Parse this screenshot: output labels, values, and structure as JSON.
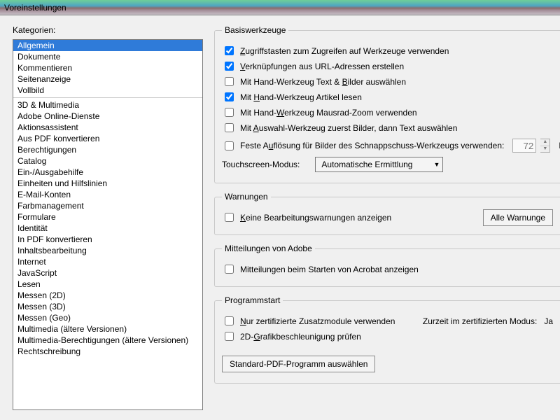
{
  "window": {
    "title": "Voreinstellungen"
  },
  "left": {
    "label": "Kategorien:",
    "groups": [
      {
        "items": [
          "Allgemein",
          "Dokumente",
          "Kommentieren",
          "Seitenanzeige",
          "Vollbild"
        ],
        "selected": 0
      },
      {
        "items": [
          "3D & Multimedia",
          "Adobe Online-Dienste",
          "Aktionsassistent",
          "Aus PDF konvertieren",
          "Berechtigungen",
          "Catalog",
          "Ein-/Ausgabehilfe",
          "Einheiten und Hilfslinien",
          "E-Mail-Konten",
          "Farbmanagement",
          "Formulare",
          "Identität",
          "In PDF konvertieren",
          "Inhaltsbearbeitung",
          "Internet",
          "JavaScript",
          "Lesen",
          "Messen (2D)",
          "Messen (3D)",
          "Messen (Geo)",
          "Multimedia (ältere Versionen)",
          "Multimedia-Berechtigungen (ältere Versionen)",
          "Rechtschreibung"
        ]
      }
    ]
  },
  "basis": {
    "legend": "Basiswerkzeuge",
    "items": [
      {
        "pre": "",
        "u": "Z",
        "post": "ugriffstasten zum Zugreifen auf Werkzeuge verwenden",
        "checked": true
      },
      {
        "pre": "",
        "u": "V",
        "post": "erknüpfungen aus URL-Adressen erstellen",
        "checked": true
      },
      {
        "pre": "Mit Hand-Werkzeug Text & ",
        "u": "B",
        "post": "ilder auswählen",
        "checked": false
      },
      {
        "pre": "Mit ",
        "u": "H",
        "post": "and-Werkzeug Artikel lesen",
        "checked": true
      },
      {
        "pre": "Mit Hand-",
        "u": "W",
        "post": "erkzeug Mausrad-Zoom verwenden",
        "checked": false
      },
      {
        "pre": "Mit ",
        "u": "A",
        "post": "uswahl-Werkzeug zuerst Bilder, dann Text auswählen",
        "checked": false
      }
    ],
    "fixedRes": {
      "pre": "Feste A",
      "u": "u",
      "post": "flösung für Bilder des Schnappschuss-Werkzeugs verwenden:",
      "value": "72",
      "unit": "Pi"
    },
    "touch": {
      "label": "Touchscreen-Modus:",
      "value": "Automatische Ermittlung"
    }
  },
  "warn": {
    "legend": "Warnungen",
    "item": {
      "pre": "",
      "u": "K",
      "post": "eine Bearbeitungswarnungen anzeigen",
      "checked": false
    },
    "button": "Alle Warnunge"
  },
  "adobe": {
    "legend": "Mitteilungen von Adobe",
    "item": {
      "pre": "Mitteilungen beim Starten von Acrobat anzeigen",
      "checked": false
    }
  },
  "start": {
    "legend": "Programmstart",
    "cert": {
      "pre": "",
      "u": "N",
      "post": "ur zertifizierte Zusatzmodule verwenden",
      "checked": false
    },
    "certStatusLabel": "Zurzeit im zertifizierten Modus:",
    "certStatusValue": "Ja",
    "gfx": {
      "pre": "2D-",
      "u": "G",
      "post": "rafikbeschleunigung prüfen",
      "checked": false
    },
    "button": "Standard-PDF-Programm auswählen"
  }
}
